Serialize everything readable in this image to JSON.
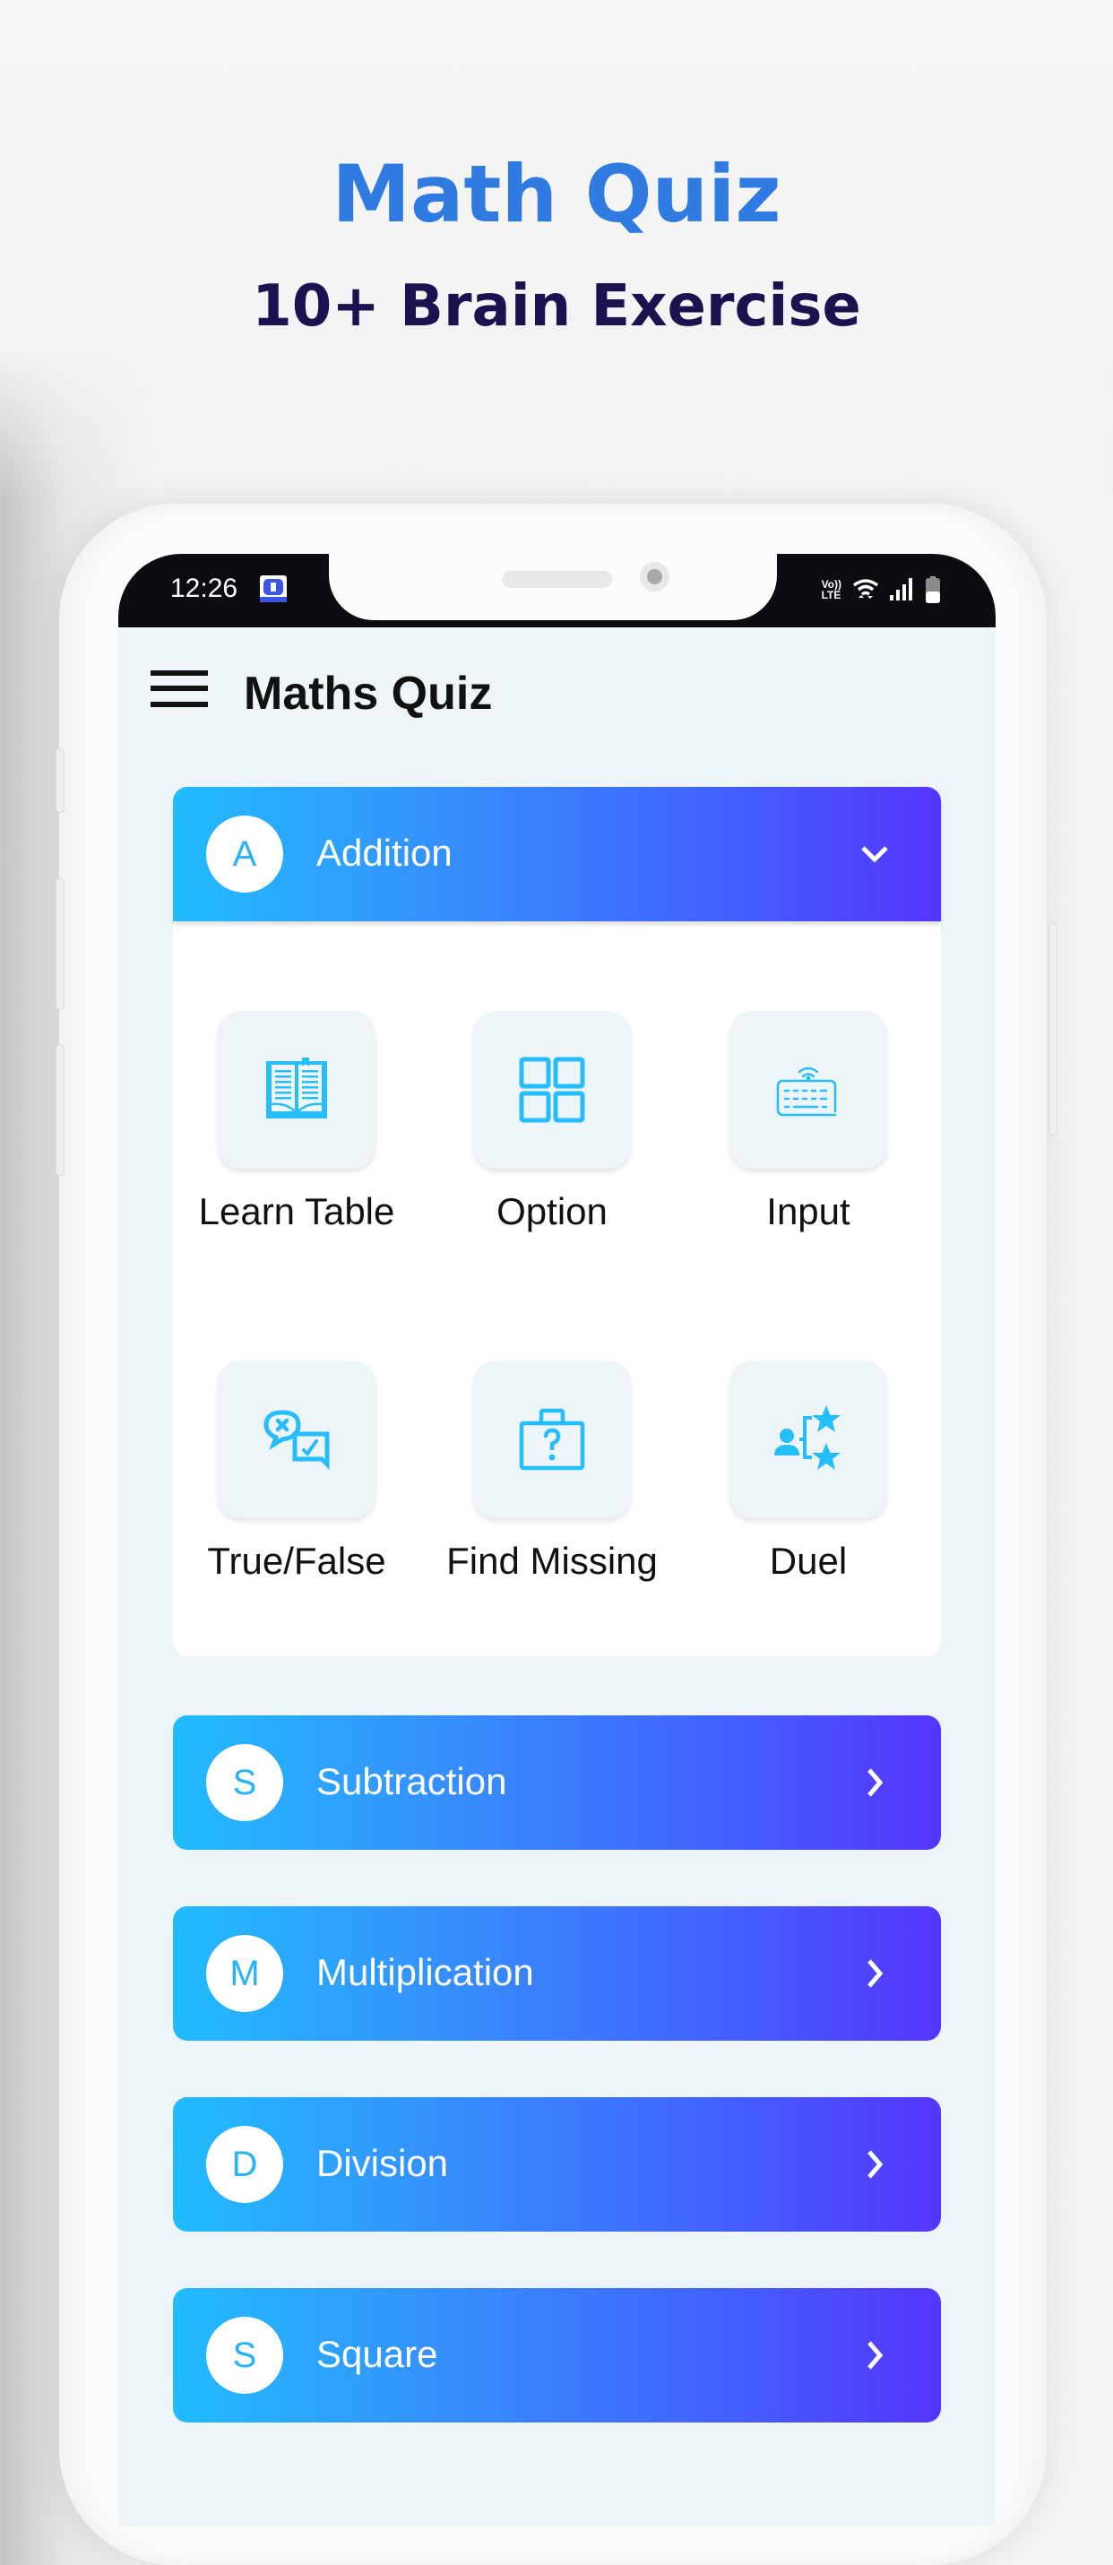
{
  "promo": {
    "title": "Math Quiz",
    "subtitle": "10+ Brain Exercise"
  },
  "status_bar": {
    "time": "12:26",
    "notification_icon": "app-shield-icon",
    "network_label_top": "Vo))",
    "network_label_bottom": "LTE",
    "icons": [
      "volte-icon",
      "wifi-icon",
      "signal-icon",
      "battery-icon"
    ]
  },
  "app_bar": {
    "menu_icon": "hamburger-menu-icon",
    "title": "Maths Quiz"
  },
  "colors": {
    "gradient_start": "#21bcfe",
    "gradient_end": "#5535fd",
    "icon_accent": "#26b3f7",
    "promo_title": "#2f7be2",
    "promo_subtitle": "#1b1250",
    "screen_bg": "#eef5f9"
  },
  "sections": [
    {
      "letter": "A",
      "label": "Addition",
      "expanded": true,
      "chevron": "chevron-down-icon",
      "items": [
        {
          "label": "Learn Table",
          "icon": "open-book-icon"
        },
        {
          "label": "Option",
          "icon": "grid-icon"
        },
        {
          "label": "Input",
          "icon": "wireless-keyboard-icon"
        },
        {
          "label": "True/False",
          "icon": "chat-true-false-icon"
        },
        {
          "label": "Find Missing",
          "icon": "question-briefcase-icon"
        },
        {
          "label": "Duel",
          "icon": "user-stars-icon"
        }
      ]
    },
    {
      "letter": "S",
      "label": "Subtraction",
      "expanded": false,
      "chevron": "chevron-right-icon"
    },
    {
      "letter": "M",
      "label": "Multiplication",
      "expanded": false,
      "chevron": "chevron-right-icon"
    },
    {
      "letter": "D",
      "label": "Division",
      "expanded": false,
      "chevron": "chevron-right-icon"
    },
    {
      "letter": "S",
      "label": "Square",
      "expanded": false,
      "chevron": "chevron-right-icon"
    }
  ]
}
